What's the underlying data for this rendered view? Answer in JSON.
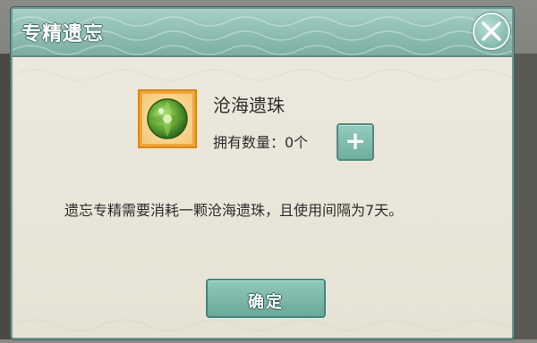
{
  "dialog": {
    "title": "专精遗忘",
    "close_icon": "close-icon"
  },
  "item": {
    "icon": "green-pearl-icon",
    "name": "沧海遗珠",
    "owned_label": "拥有数量：0个",
    "owned_count": 0,
    "add_icon": "plus-icon",
    "add_symbol": "+"
  },
  "description": "遗忘专精需要消耗一颗沧海遗珠，且使用间隔为7天。",
  "buttons": {
    "confirm_label": "确定"
  },
  "colors": {
    "title_bar": "#8dbdb2",
    "button": "#6fae9f",
    "item_frame": "#f1a539",
    "content_bg": "#e7e3d6"
  }
}
